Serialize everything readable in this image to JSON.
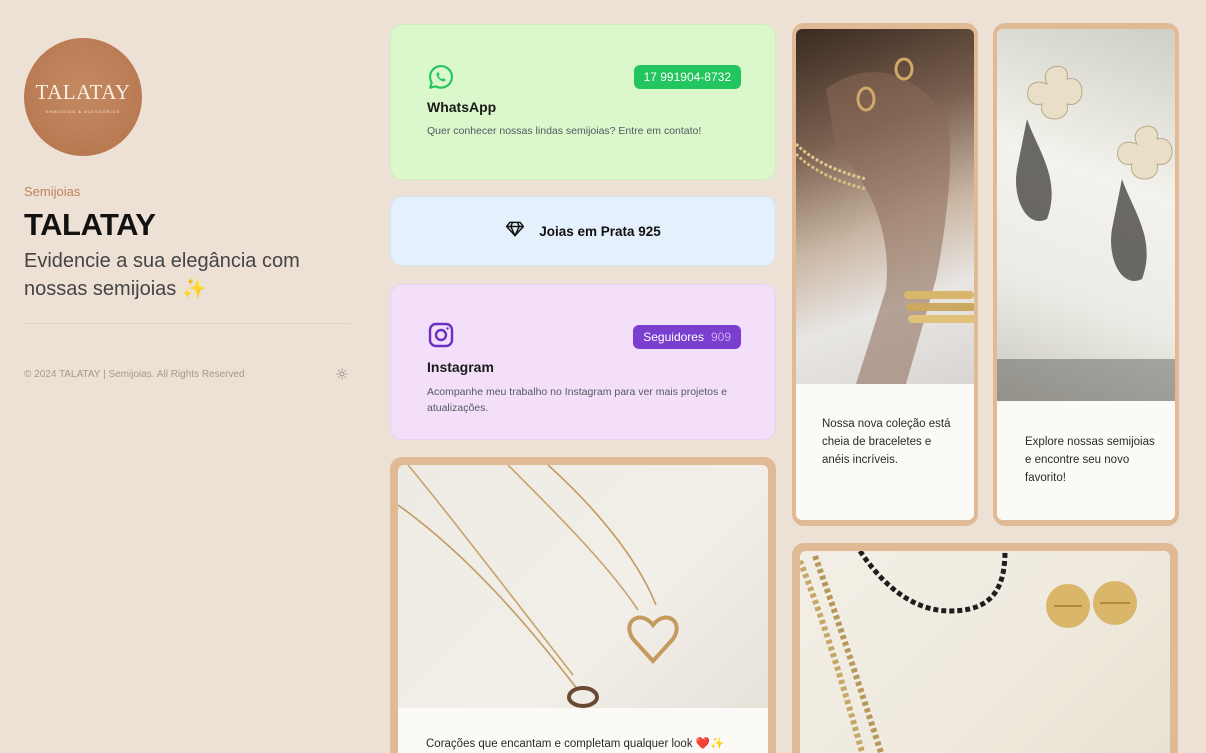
{
  "profile": {
    "logo_text": "TALATAY",
    "logo_subtext": "Semijoias & Acessórios",
    "category": "Semijoias",
    "name": "TALATAY",
    "tagline": "Evidencie a sua elegância com nossas semijoias ✨",
    "copyright": "© 2024 TALATAY | Semijoias. All Rights Reserved"
  },
  "whatsapp": {
    "title": "WhatsApp",
    "badge": "17 991904-8732",
    "description": "Quer conhecer nossas lindas semijoias? Entre em contato!"
  },
  "prata": {
    "label": "Joias em Prata 925"
  },
  "instagram": {
    "title": "Instagram",
    "badge_label": "Seguidores",
    "badge_count": "909",
    "description": "Acompanhe meu trabalho no Instagram para ver mais projetos e atualizações."
  },
  "posts": [
    {
      "caption": "Corações que encantam e completam qualquer look ❤️✨"
    },
    {
      "caption": "Nossa nova coleção está cheia de braceletes e anéis incríveis."
    },
    {
      "caption": "Explore nossas semijoias e encontre seu novo favorito!"
    }
  ],
  "colors": {
    "background": "#ede1d6",
    "whatsapp_green": "#22c55e",
    "instagram_purple": "#7b3fcf",
    "accent_brown": "#c0835a"
  }
}
